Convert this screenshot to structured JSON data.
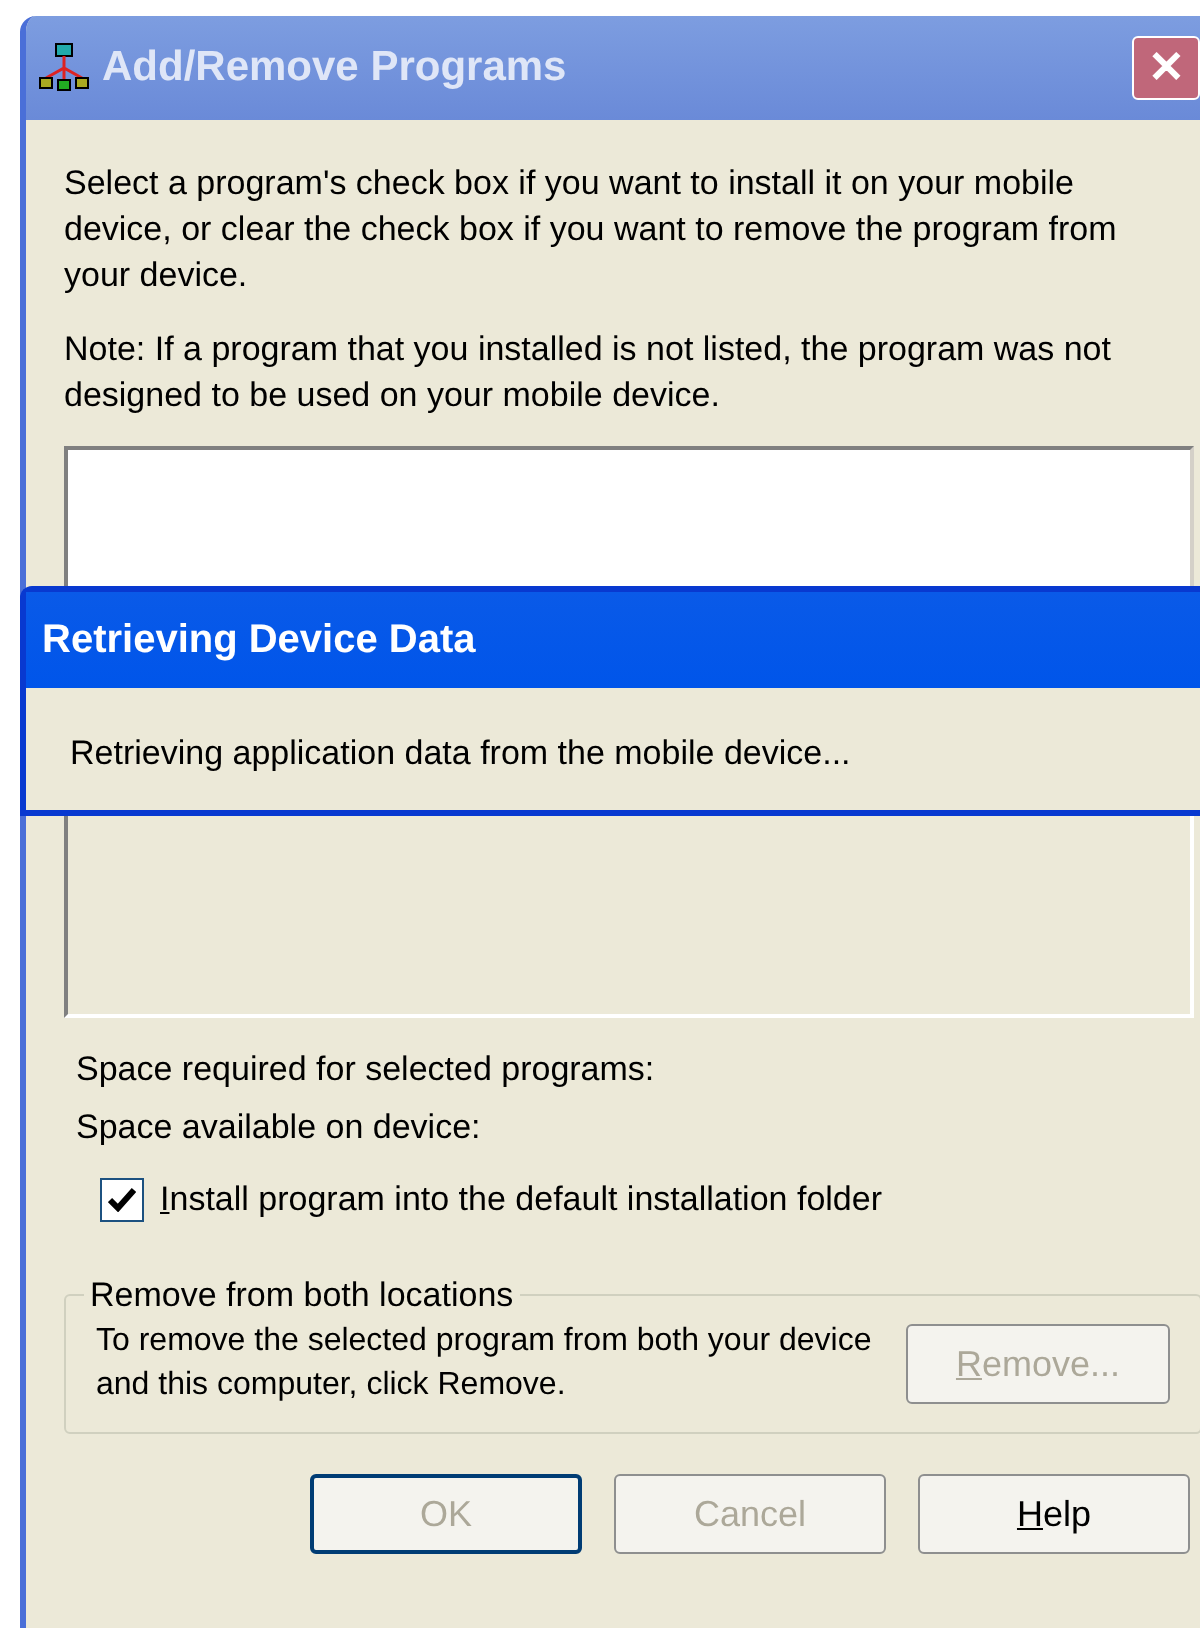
{
  "window": {
    "title": "Add/Remove Programs",
    "close": "✕"
  },
  "intro": "Select a program's check box if you want to install it on your mobile device, or clear the check box if you want to remove the program from your device.",
  "note": "Note:  If a program that you installed is not listed, the program was not designed to be used on your mobile device.",
  "space_required": "Space required for selected programs:",
  "space_available": "Space available on device:",
  "install_default": {
    "label": "Install program into the default installation folder",
    "mnemonic_first": true,
    "checked": true
  },
  "remove_group": {
    "title": "Remove from both locations",
    "text": "To remove the selected program from both your device and this computer, click Remove.",
    "button": {
      "label": "Remove...",
      "mnemonic_first": true,
      "disabled": true
    }
  },
  "buttons": [
    {
      "label": "OK",
      "disabled": true,
      "default": true
    },
    {
      "label": "Cancel",
      "disabled": true,
      "default": false
    },
    {
      "label": "Help",
      "disabled": false,
      "default": false,
      "mnemonic_first": true
    }
  ],
  "progress_dialog": {
    "title": "Retrieving Device Data",
    "message": "Retrieving application data from the mobile device..."
  }
}
